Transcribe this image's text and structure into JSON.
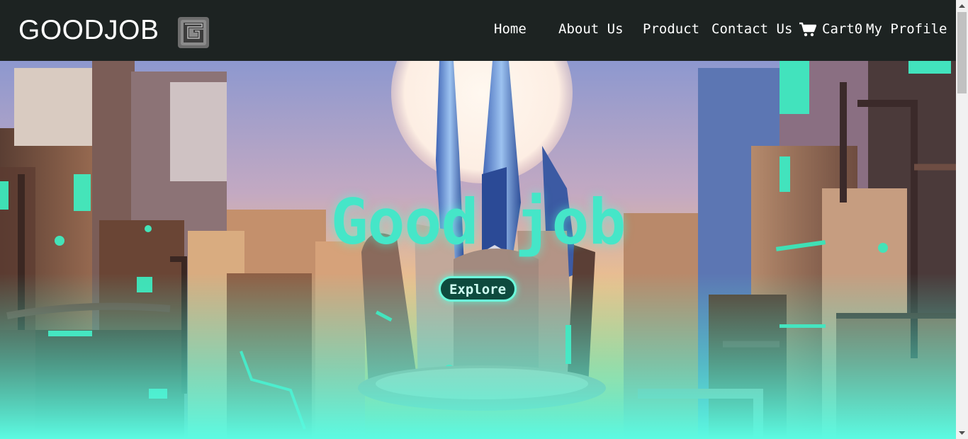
{
  "header": {
    "brand": "GOODJOB",
    "logo_icon": "goodjob-logo-icon",
    "nav": {
      "home": "Home",
      "about": "About Us",
      "product": "Product",
      "contact": "Contact Us",
      "cart": "Cart0",
      "profile": "My Profile"
    },
    "cart_icon": "cart-icon"
  },
  "hero": {
    "title": "Good job",
    "button": "Explore"
  },
  "colors": {
    "navbar": "#1d2322",
    "accent": "#45e6c8",
    "glow": "#6dfbdc"
  }
}
